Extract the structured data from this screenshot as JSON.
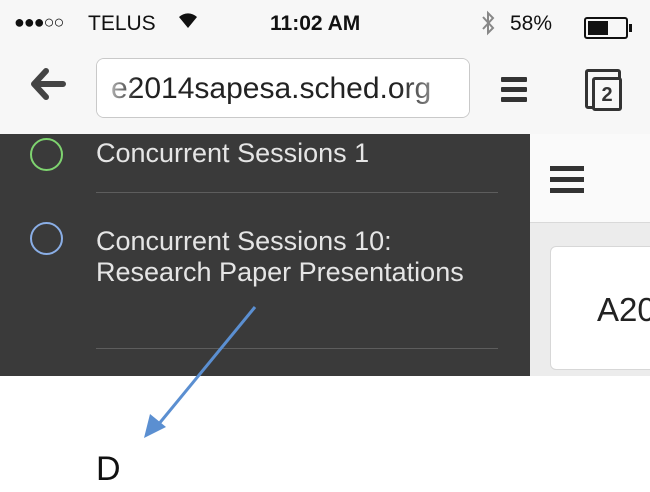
{
  "status_bar": {
    "signal": "●●●○○",
    "carrier": "TELUS",
    "time": "11:02 AM",
    "battery": "58%",
    "battery_level": 0.58
  },
  "browser": {
    "url": "e2014sapesa.sched.org",
    "tab_count": "2"
  },
  "sidebar": {
    "items": [
      {
        "label": "Concurrent Sessions 1",
        "color": "#7ed36f"
      },
      {
        "label": "Concurrent Sessions 10: Research Paper Presentations",
        "color": "#8aaee6"
      },
      {
        "label": "",
        "color": "#e6a24a"
      }
    ]
  },
  "content": {
    "card_text": "A20"
  },
  "annotation": {
    "letter": "D",
    "arrow_color": "#5b8fd1"
  }
}
